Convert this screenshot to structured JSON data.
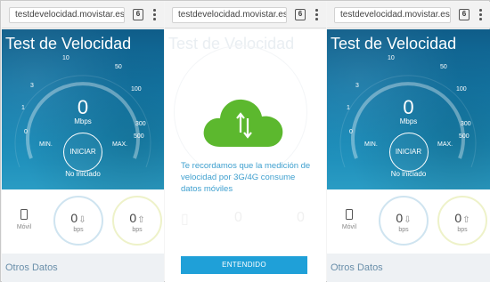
{
  "browser": {
    "url": "testdevelocidad.movistar.es/m",
    "tab_count": "6"
  },
  "app": {
    "title": "Test de Velocidad",
    "scale": [
      "0",
      "1",
      "3",
      "10",
      "50",
      "100",
      "300",
      "500"
    ],
    "min_label": "MIN.",
    "max_label": "MAX.",
    "speed_value": "0",
    "speed_unit": "Mbps",
    "start_button": "INICIAR",
    "status": "No iniciado",
    "network_label": "Móvil",
    "download": {
      "value": "0",
      "unit": "bps",
      "icon": "arrow-down-icon"
    },
    "upload": {
      "value": "0",
      "unit": "bps",
      "icon": "arrow-up-icon"
    },
    "other_data": "Otros Datos"
  },
  "modal": {
    "icon": "cloud-data-icon",
    "message": "Te recordamos que la medición de velocidad por 3G/4G consume datos móviles",
    "ok_button": "ENTENDIDO",
    "colors": {
      "cloud": "#5cb82e",
      "text": "#3fa0cf",
      "button": "#1fa0d8"
    }
  },
  "colors": {
    "hero_top": "#0f5d89",
    "hero_bottom": "#2a9cc4",
    "other_data_text": "#6a8faa"
  }
}
